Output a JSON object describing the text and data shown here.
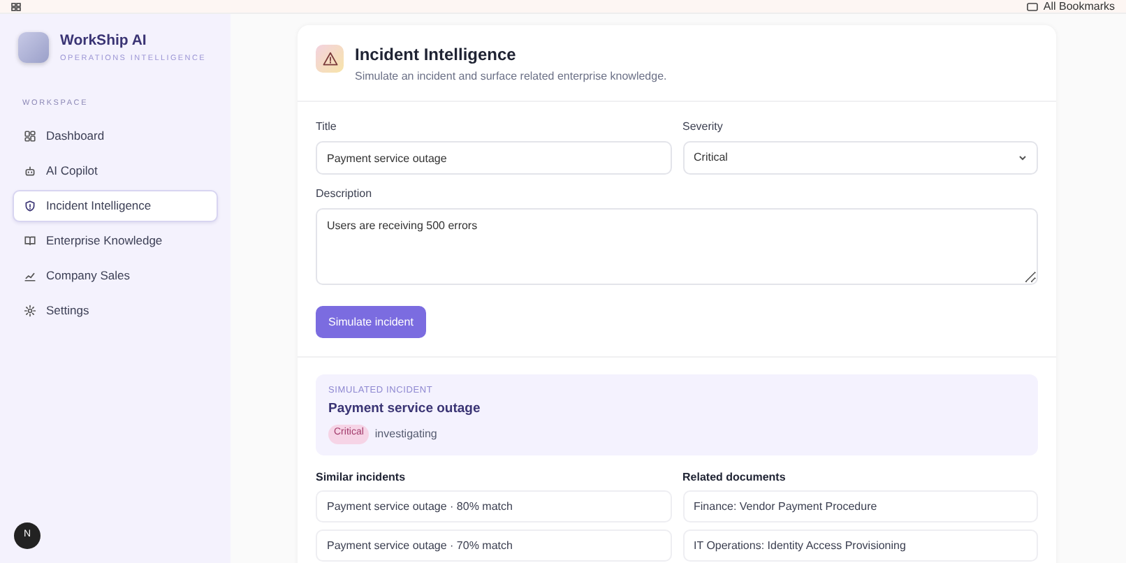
{
  "bookmarks_bar": {
    "label": "All Bookmarks"
  },
  "sidebar": {
    "brand": {
      "name": "WorkShip AI",
      "tagline": "OPERATIONS INTELLIGENCE"
    },
    "section": "WORKSPACE",
    "items": [
      {
        "label": "Dashboard",
        "selected": false
      },
      {
        "label": "AI Copilot",
        "selected": false
      },
      {
        "label": "Incident Intelligence",
        "selected": true
      },
      {
        "label": "Enterprise Knowledge",
        "selected": false
      },
      {
        "label": "Company Sales",
        "selected": false
      },
      {
        "label": "Settings",
        "selected": false
      }
    ],
    "dev_badge": "N"
  },
  "header": {
    "title": "Incident Intelligence",
    "subtitle": "Simulate an incident and surface related enterprise knowledge."
  },
  "form": {
    "title_label": "Title",
    "title_value": "Payment service outage",
    "severity_label": "Severity",
    "severity_value": "Critical",
    "description_label": "Description",
    "description_value": "Users are receiving 500 errors",
    "submit": "Simulate incident"
  },
  "result": {
    "eyebrow": "SIMULATED INCIDENT",
    "title": "Payment service outage",
    "severity": "Critical",
    "status": "investigating"
  },
  "similar": {
    "heading": "Similar incidents",
    "items": [
      "Payment service outage · 80% match",
      "Payment service outage · 70% match"
    ]
  },
  "related": {
    "heading": "Related documents",
    "items": [
      "Finance: Vendor Payment Procedure",
      "IT Operations: Identity Access Provisioning"
    ]
  }
}
